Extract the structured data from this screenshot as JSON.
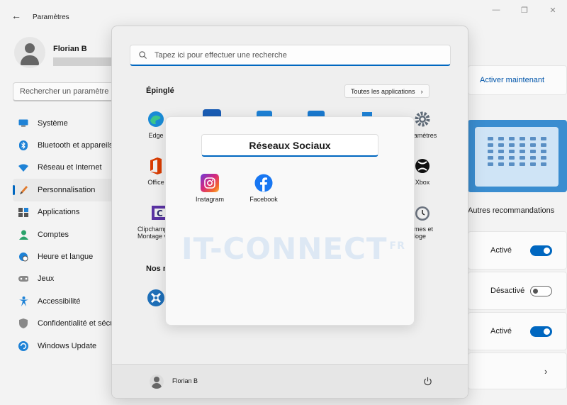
{
  "settings": {
    "title": "Paramètres",
    "user_name": "Florian B",
    "search_placeholder": "Rechercher un paramètre",
    "nav": [
      {
        "label": "Système",
        "icon": "monitor-icon"
      },
      {
        "label": "Bluetooth et appareils",
        "icon": "bluetooth-icon"
      },
      {
        "label": "Réseau et Internet",
        "icon": "wifi-icon"
      },
      {
        "label": "Personnalisation",
        "icon": "brush-icon",
        "active": true
      },
      {
        "label": "Applications",
        "icon": "apps-icon"
      },
      {
        "label": "Comptes",
        "icon": "account-icon"
      },
      {
        "label": "Heure et langue",
        "icon": "globe-clock-icon"
      },
      {
        "label": "Jeux",
        "icon": "gamepad-icon"
      },
      {
        "label": "Accessibilité",
        "icon": "accessibility-icon"
      },
      {
        "label": "Confidentialité et sécurité",
        "icon": "shield-icon"
      },
      {
        "label": "Windows Update",
        "icon": "update-icon"
      }
    ],
    "activate_label": "Activer maintenant",
    "recommendations_title": "Autres recommandations",
    "toggles": [
      {
        "label": "Activé",
        "state": "on"
      },
      {
        "label": "Désactivé",
        "state": "off"
      },
      {
        "label": "Activé",
        "state": "on"
      }
    ],
    "colors": {
      "accent": "#0067c0",
      "preview_bg": "#3a8dd0"
    }
  },
  "start_menu": {
    "search_placeholder": "Tapez ici pour effectuer une recherche",
    "pinned_title": "Épinglé",
    "all_apps_label": "Toutes les applications",
    "pinned": [
      {
        "label": "Edge",
        "icon": "edge-icon"
      },
      {
        "label": "Office",
        "icon": "office-icon"
      },
      {
        "label": "Clipchamp – Montage vidéo",
        "label_display": "Clipchamp\nMontage v",
        "icon": "clipchamp-icon"
      },
      {
        "label": "Paramètres",
        "label_display": "aramètres",
        "icon": "settings-gear-icon"
      },
      {
        "label": "Xbox",
        "icon": "xbox-icon"
      },
      {
        "label": "Alarmes et horloge",
        "label_display": "armes et\norloge",
        "icon": "alarm-clock-icon"
      }
    ],
    "recommended_title": "Nos r",
    "user_name": "Florian B"
  },
  "folder": {
    "name": "Réseaux Sociaux",
    "apps": [
      {
        "label": "Instagram",
        "icon": "instagram-icon"
      },
      {
        "label": "Facebook",
        "icon": "facebook-icon"
      }
    ]
  },
  "watermark": {
    "text": "IT-CONNECT",
    "suffix": "FR"
  }
}
